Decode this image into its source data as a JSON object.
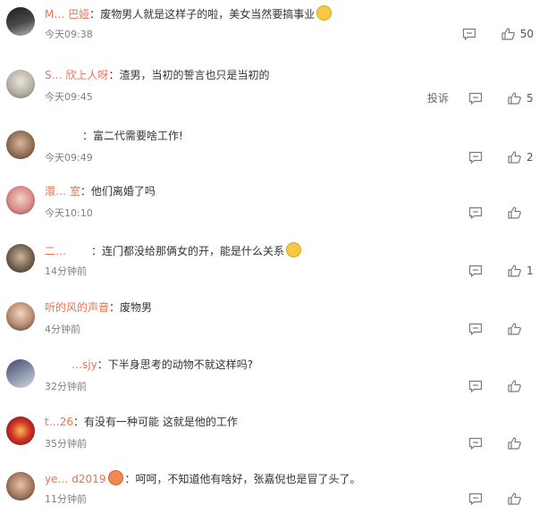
{
  "comments": [
    {
      "username": "M…  巴娅",
      "text": "废物男人就是这样子的啦，美女当然要搞事业",
      "emoji": "cat-face-emoji",
      "time": "今天09:38",
      "likes": "50",
      "report": ""
    },
    {
      "username": "S…  欣上人呀",
      "text": "渣男，当初的誓言也只是当初的",
      "emoji": "",
      "time": "今天09:45",
      "likes": "5",
      "report": "投诉"
    },
    {
      "username": "",
      "text": "富二代需要啥工作!",
      "emoji": "",
      "time": "今天09:49",
      "likes": "2",
      "report": ""
    },
    {
      "username": "澴…  室",
      "text": "他们离婚了吗",
      "emoji": "",
      "time": "今天10:10",
      "likes": "",
      "report": ""
    },
    {
      "username": "二…",
      "text": "连门都没给那俩女的开，能是什么关系",
      "emoji": "laughing-crying-emoji",
      "time": "14分钟前",
      "likes": "1",
      "report": ""
    },
    {
      "username": "听的风的声音",
      "text": "废物男",
      "emoji": "",
      "time": "4分钟前",
      "likes": "",
      "report": ""
    },
    {
      "username": "…sjy",
      "text": "下半身思考的动物不就这样吗?",
      "emoji": "",
      "time": "32分钟前",
      "likes": "",
      "report": ""
    },
    {
      "username": "t…26",
      "text": "有没有一种可能 这就是他的工作",
      "emoji": "",
      "time": "35分钟前",
      "likes": "",
      "report": ""
    },
    {
      "username": "ye…  d2019",
      "text": "呵呵，不知道他有啥好，张嘉倪也是冒了头了。",
      "emoji": "",
      "time": "11分钟前",
      "likes": "",
      "report": "",
      "badge": "fan-badge"
    }
  ],
  "colors": {
    "username": "#eb7350",
    "text": "#333333",
    "time": "#808080",
    "icon": "#7a7a7a"
  }
}
